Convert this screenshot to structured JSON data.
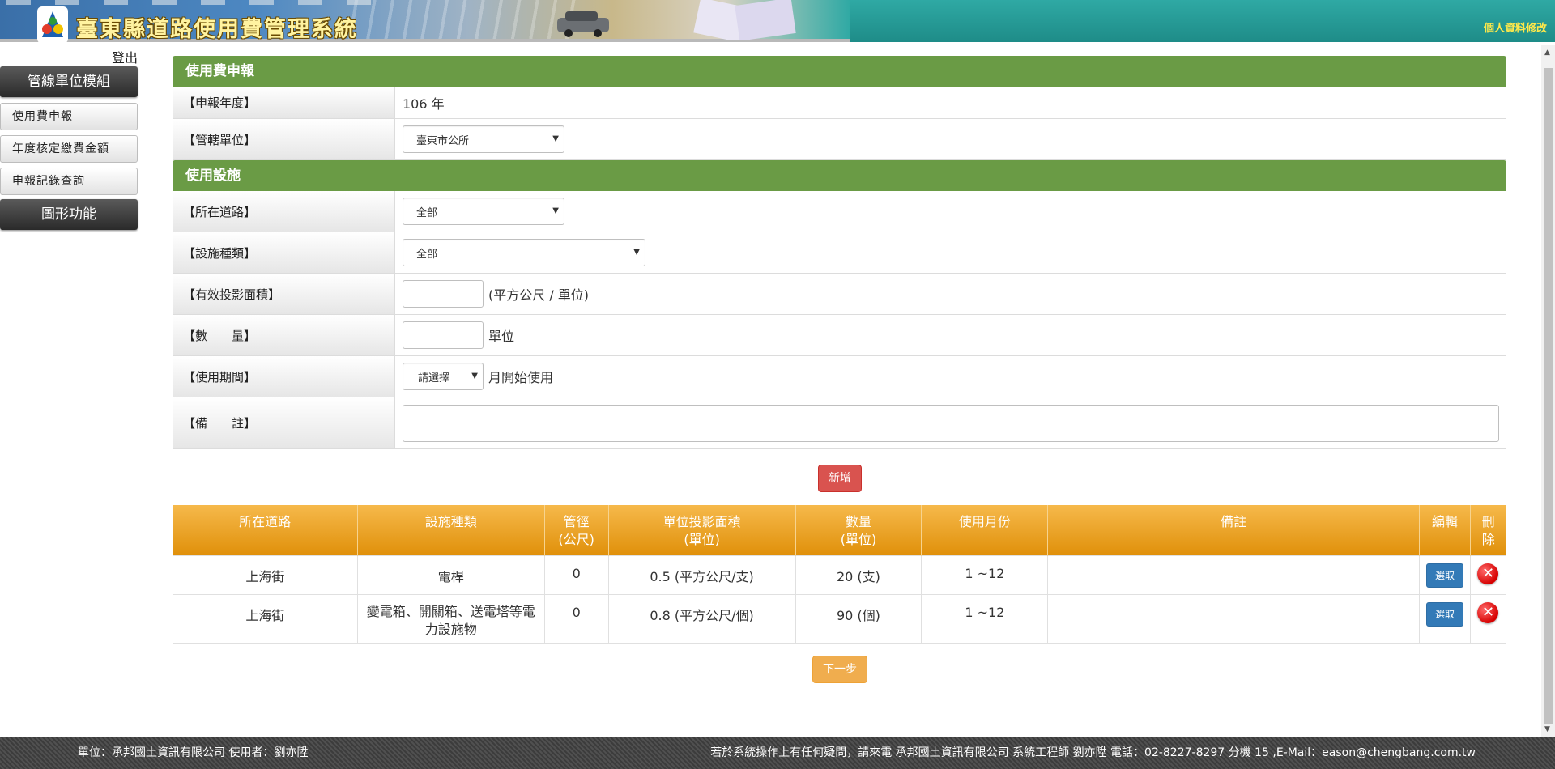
{
  "header": {
    "title": "臺東縣道路使用費管理系統",
    "personal_link": "個人資料修改"
  },
  "sidebar": {
    "logout": "登出",
    "module1": "管線單位模組",
    "items": [
      "使用費申報",
      "年度核定繳費金額",
      "申報記錄查詢"
    ],
    "module2": "圖形功能"
  },
  "fee_section": {
    "title": "使用費申報",
    "year_label": "【申報年度】",
    "year_value": "106 年",
    "unit_label": "【管轄單位】",
    "unit_selected": "臺東市公所"
  },
  "facility_section": {
    "title": "使用設施",
    "road_label": "【所在道路】",
    "road_selected": "全部",
    "type_label": "【設施種類】",
    "type_selected": "全部",
    "area_label": "【有效投影面積】",
    "area_unit": "(平方公尺 / 單位)",
    "qty_label": "【數　　量】",
    "qty_unit": "單位",
    "period_label": "【使用期間】",
    "period_selected": "請選擇",
    "period_suffix": "月開始使用",
    "note_label": "【備　　註】"
  },
  "add_button": "新增",
  "table": {
    "headers": [
      "所在道路",
      "設施種類",
      "管徑\n(公尺)",
      "單位投影面積\n(單位)",
      "數量\n(單位)",
      "使用月份",
      "備註",
      "編輯",
      "刪\n除"
    ],
    "rows": [
      {
        "road": "上海街",
        "type": "電桿",
        "diameter": "0",
        "area": "0.5 (平方公尺/支)",
        "qty": "20 (支)",
        "months": "1 ~12",
        "note": "",
        "edit": "選取"
      },
      {
        "road": "上海街",
        "type": "變電箱、開關箱、送電塔等電力設施物",
        "diameter": "0",
        "area": "0.8 (平方公尺/個)",
        "qty": "90 (個)",
        "months": "1 ~12",
        "note": "",
        "edit": "選取"
      }
    ]
  },
  "next_button": "下一步",
  "footer": {
    "left": "單位：承邦國土資訊有限公司 使用者：劉亦陞",
    "right": "若於系統操作上有任何疑問，請來電 承邦國土資訊有限公司 系統工程師 劉亦陞 電話：02-8227-8297 分機 15 ,E-Mail：eason@chengbang.com.tw"
  },
  "colors": {
    "section_green": "#6a9b45",
    "table_header_orange": "#e0900a",
    "add_red": "#d9534f",
    "next_orange": "#f0ad4e",
    "pick_blue": "#337ab7"
  }
}
